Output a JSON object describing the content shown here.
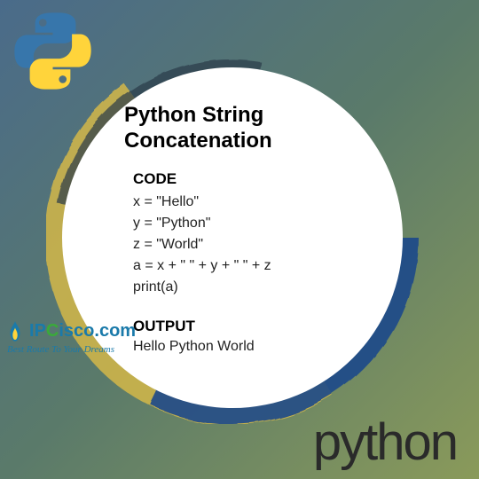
{
  "title": "Python String Concatenation",
  "code": {
    "heading": "CODE",
    "lines": [
      "x = \"Hello\"",
      "y = \"Python\"",
      "z = \"World\"",
      "a = x + \" \" + y + \" \" + z",
      "print(a)"
    ]
  },
  "output": {
    "heading": "OUTPUT",
    "text": "Hello Python World"
  },
  "brand": {
    "ipcisco_name": "IPCisco.com",
    "ipcisco_tagline": "Best Route To Your Dreams",
    "python_text": "python"
  },
  "colors": {
    "python_blue": "#3776ab",
    "python_yellow": "#ffd43b",
    "ipcisco_blue": "#1a7aaa",
    "ipcisco_green": "#3aaa3a",
    "ring_blue": "#1e4a8a",
    "ring_yellow": "#d4b84a"
  }
}
